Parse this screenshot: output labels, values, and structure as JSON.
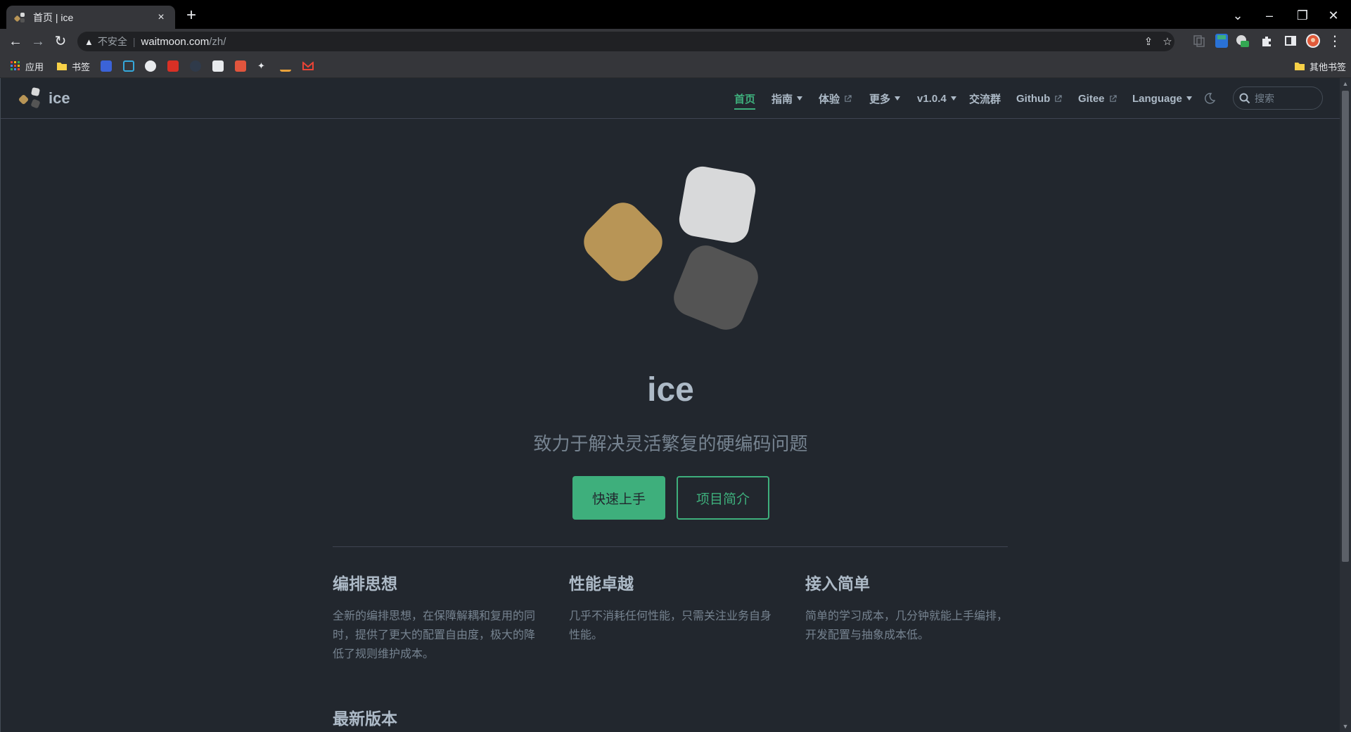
{
  "browser": {
    "tab_title": "首页 | ice",
    "tab_close": "×",
    "new_tab": "+",
    "window_controls": {
      "dropdown": "⌄",
      "minimize": "–",
      "restore": "❐",
      "close": "✕"
    },
    "back": "←",
    "forward": "→",
    "reload": "↻",
    "security_warning": "不安全",
    "url_host": "waitmoon.com",
    "url_path": "/zh/",
    "bookmarks": [
      {
        "label": "应用",
        "icon": "apps-grid-icon"
      },
      {
        "label": "书签",
        "icon": "folder-icon"
      },
      {
        "label": "",
        "icon": "baidu-icon"
      },
      {
        "label": "",
        "icon": "bilibili-icon"
      },
      {
        "label": "",
        "icon": "github-icon"
      },
      {
        "label": "",
        "icon": "g-icon"
      },
      {
        "label": "",
        "icon": "dark-site-icon"
      },
      {
        "label": "",
        "icon": "cloud-icon"
      },
      {
        "label": "",
        "icon": "red-site-icon"
      },
      {
        "label": "",
        "icon": "rabbit-icon"
      },
      {
        "label": "",
        "icon": "juejin-icon"
      },
      {
        "label": "",
        "icon": "gmail-icon"
      }
    ],
    "other_bookmarks": "其他书签"
  },
  "site": {
    "name": "ice",
    "nav": [
      {
        "label": "首页",
        "active": true
      },
      {
        "label": "指南",
        "dropdown": true
      },
      {
        "label": "体验",
        "external": true
      },
      {
        "label": "更多",
        "dropdown": true
      },
      {
        "label": "v1.0.4",
        "dropdown": true
      },
      {
        "label": "交流群"
      },
      {
        "label": "Github",
        "external": true
      },
      {
        "label": "Gitee",
        "external": true
      },
      {
        "label": "Language",
        "dropdown": true
      }
    ],
    "search_placeholder": "搜索"
  },
  "hero": {
    "title": "ice",
    "description": "致力于解决灵活繁复的硬编码问题",
    "primary_action": "快速上手",
    "secondary_action": "项目简介"
  },
  "features": [
    {
      "title": "编排思想",
      "text": "全新的编排思想，在保障解耦和复用的同时，提供了更大的配置自由度，极大的降低了规则维护成本。"
    },
    {
      "title": "性能卓越",
      "text": "几乎不消耗任何性能，只需关注业务自身性能。"
    },
    {
      "title": "接入简单",
      "text": "简单的学习成本，几分钟就能上手编排，开发配置与抽象成本低。"
    }
  ],
  "latest_heading": "最新版本",
  "colors": {
    "brand_green": "#3eaf7c",
    "logo_gold": "#b89556",
    "logo_light": "#d8d9da",
    "logo_dark": "#545454",
    "page_bg": "#22272e"
  }
}
